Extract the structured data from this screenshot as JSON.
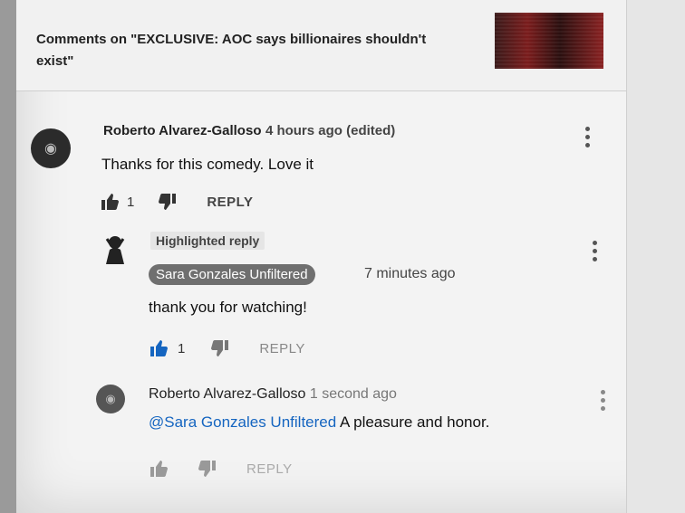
{
  "header": {
    "title": "Comments on \"EXCLUSIVE: AOC says billionaires shouldn't exist\""
  },
  "comments": [
    {
      "author": "Roberto Alvarez-Galloso",
      "time": "4 hours ago (edited)",
      "text": "Thanks for this comedy. Love it",
      "likes": "1",
      "reply_label": "REPLY"
    },
    {
      "badge": "Highlighted reply",
      "author": "Sara Gonzales Unfiltered",
      "time": "7 minutes ago",
      "text": "thank you for watching!",
      "likes": "1",
      "reply_label": "REPLY"
    },
    {
      "author": "Roberto Alvarez-Galloso",
      "time": "1 second ago",
      "mention": "@Sara Gonzales Unfiltered",
      "text": "A pleasure and honor.",
      "reply_label": "REPLY"
    }
  ],
  "colors": {
    "mention": "#1565c0",
    "liked": "#1565c0",
    "author_pill": "#6f6f6f"
  }
}
